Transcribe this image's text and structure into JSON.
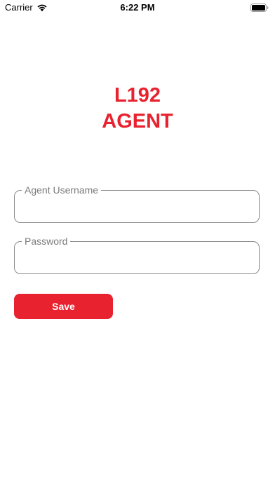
{
  "status_bar": {
    "carrier": "Carrier",
    "time": "6:22 PM",
    "wifi_icon": "wifi-icon",
    "battery_icon": "battery-full-icon"
  },
  "title": {
    "line1": "L192",
    "line2": "AGENT"
  },
  "form": {
    "username": {
      "label": "Agent Username",
      "value": ""
    },
    "password": {
      "label": "Password",
      "value": ""
    },
    "save_label": "Save"
  },
  "colors": {
    "brand_red": "#e8222f",
    "field_border": "#8a8a8a",
    "label_gray": "#7a7a7a",
    "background": "#ffffff"
  }
}
